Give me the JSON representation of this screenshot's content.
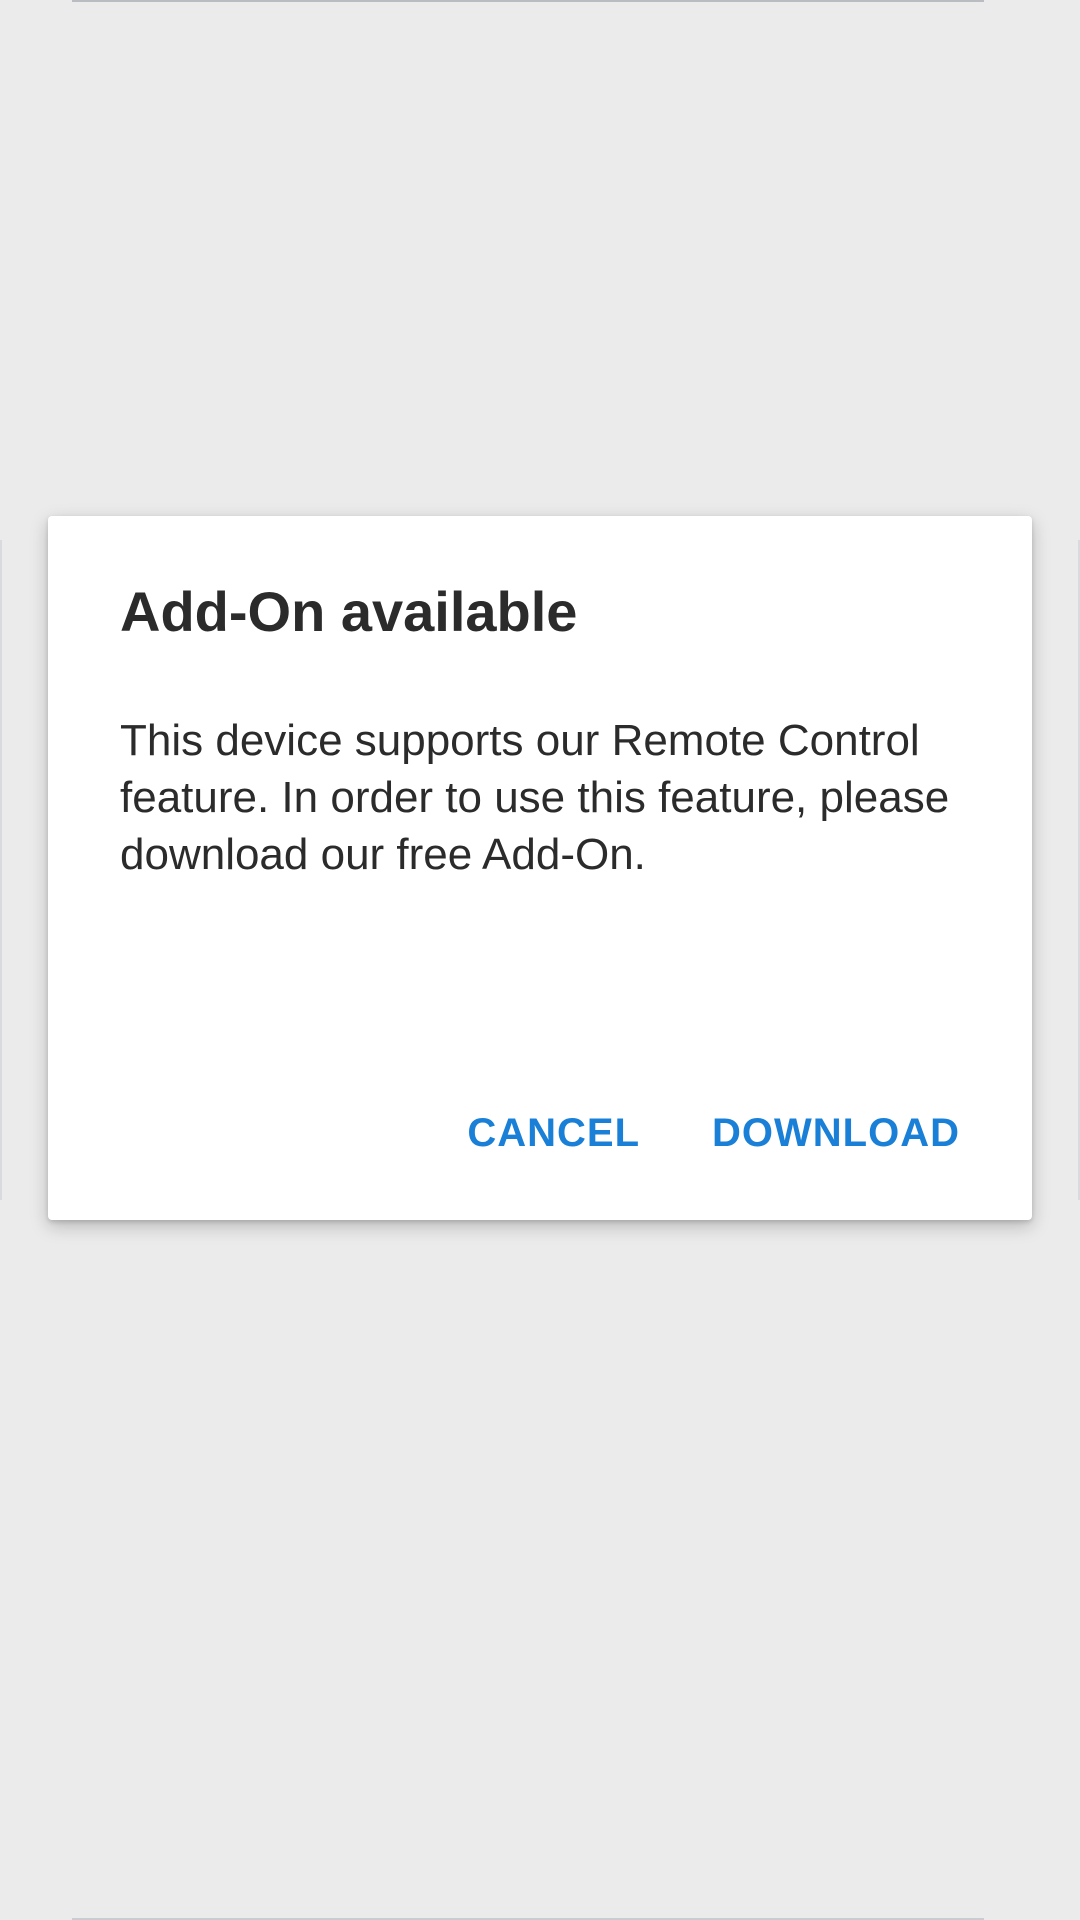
{
  "dialog": {
    "title": "Add-On available",
    "message": "This device supports our Remote Control feature. In order to use this feature, please download our free Add-On.",
    "cancel_label": "CANCEL",
    "download_label": "DOWNLOAD"
  },
  "colors": {
    "accent": "#1a7fd6",
    "text": "#2b2b2b",
    "scrim": "#ebebeb",
    "surface": "#ffffff"
  }
}
